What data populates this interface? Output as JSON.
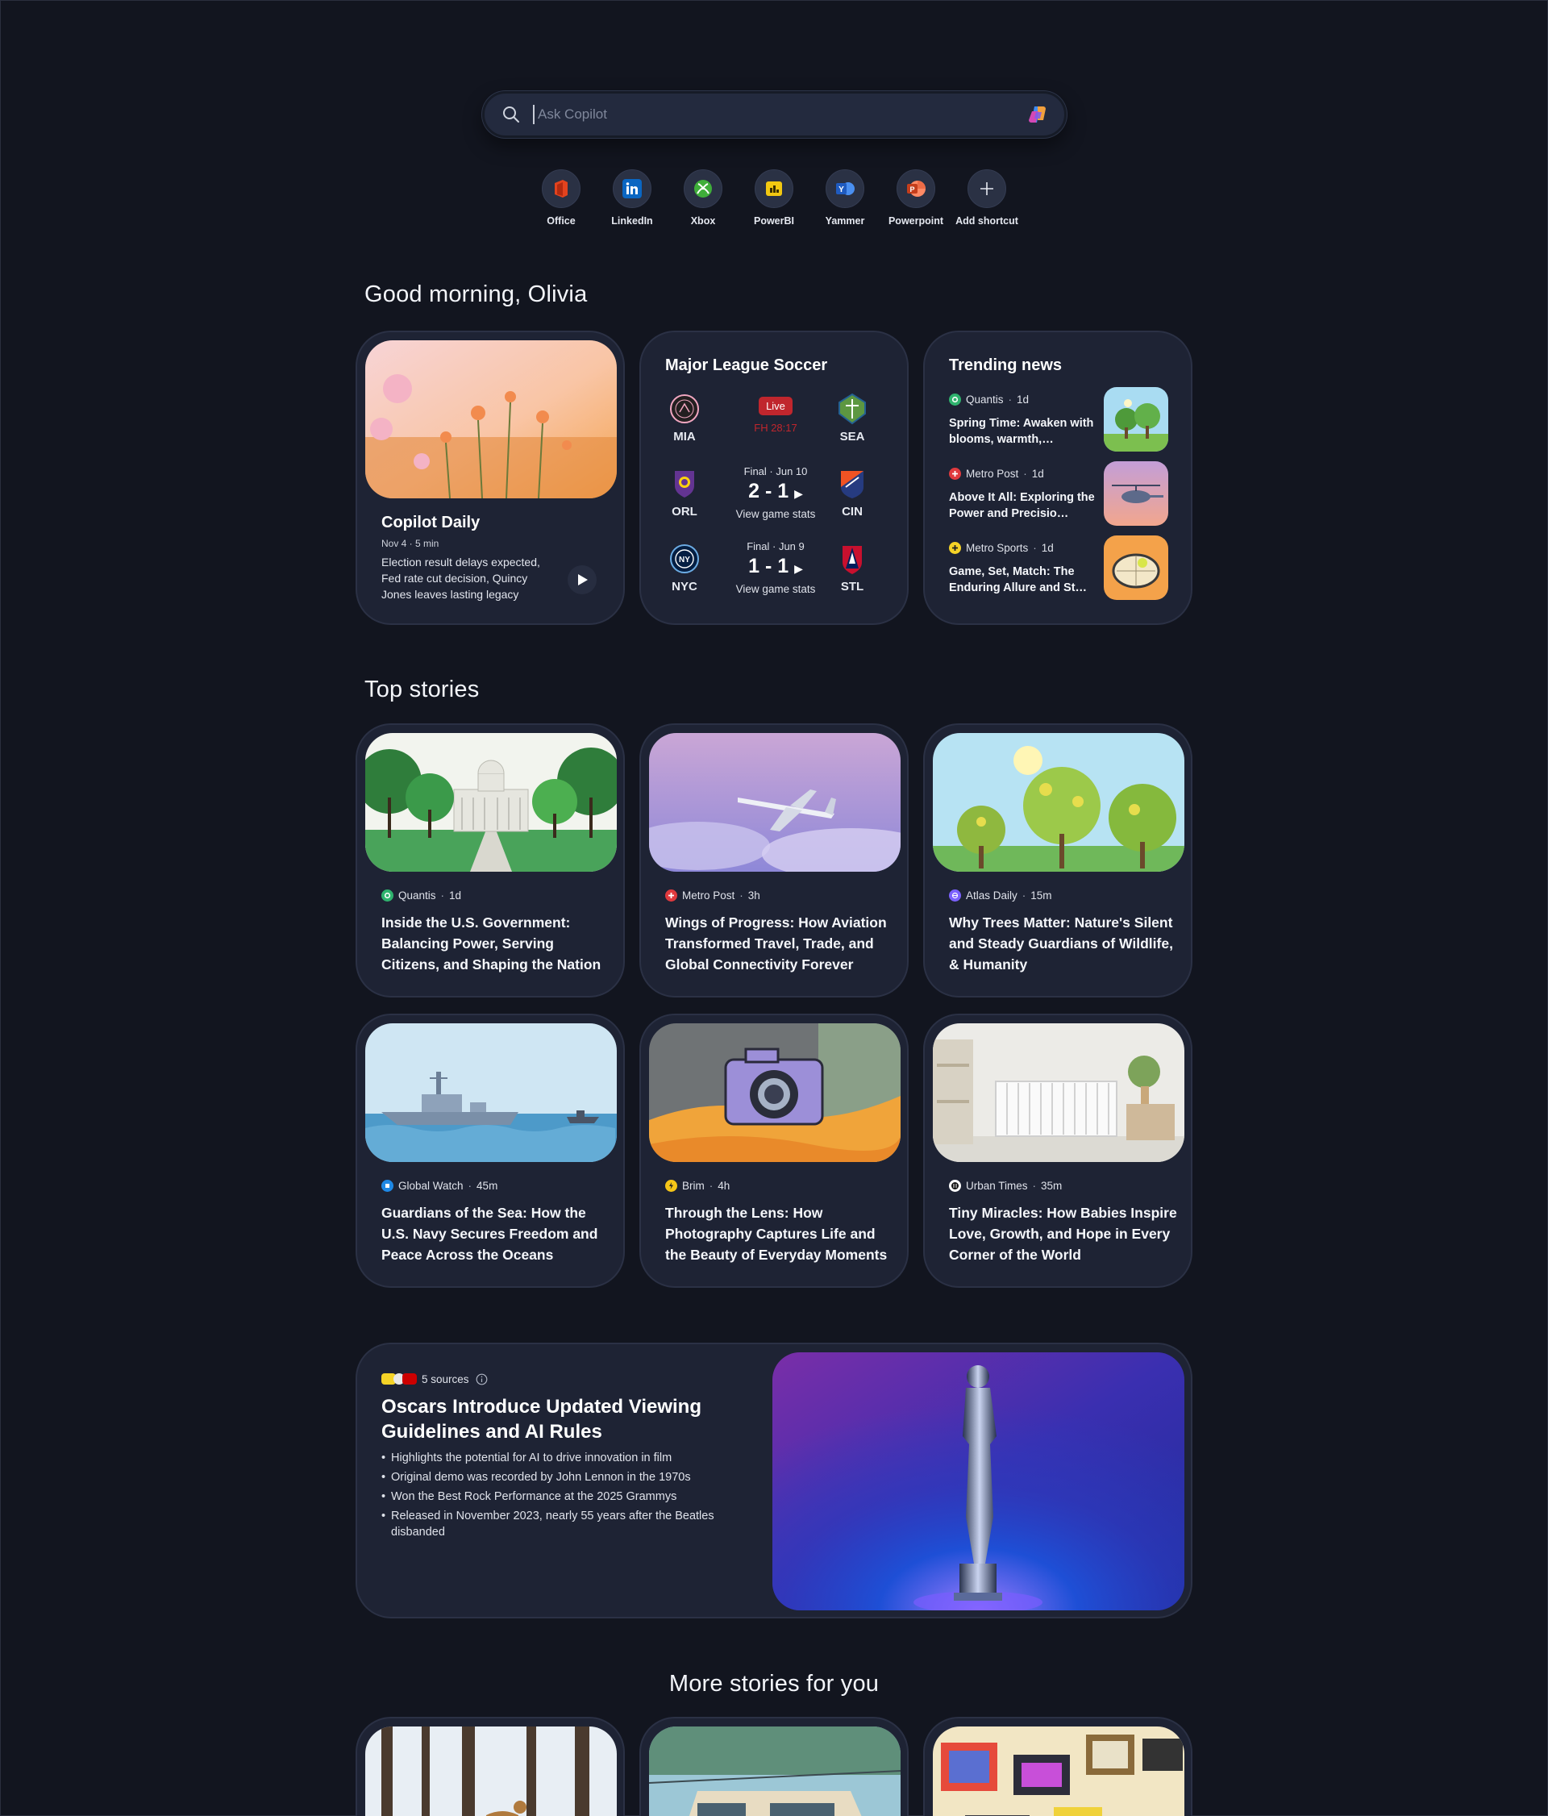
{
  "search": {
    "placeholder": "Ask Copilot"
  },
  "shortcuts": [
    {
      "label": "Office",
      "icon": "office-icon",
      "color": "#e2431e"
    },
    {
      "label": "LinkedIn",
      "icon": "linkedin-icon",
      "color": "#0a66c2"
    },
    {
      "label": "Xbox",
      "icon": "xbox-icon",
      "color": "#3fae3a"
    },
    {
      "label": "PowerBI",
      "icon": "powerbi-icon",
      "color": "#f2c811"
    },
    {
      "label": "Yammer",
      "icon": "yammer-icon",
      "color": "#2f6fd1"
    },
    {
      "label": "Powerpoint",
      "icon": "powerpoint-icon",
      "color": "#d24726"
    },
    {
      "label": "Add shortcut",
      "icon": "plus-icon",
      "color": "#ffffff"
    }
  ],
  "greeting": "Good morning, Olivia",
  "copilot_daily": {
    "title": "Copilot Daily",
    "meta": "Nov 4 · 5 min",
    "summary": "Election result delays expected, Fed rate cut decision, Quincy Jones leaves lasting legacy"
  },
  "soccer": {
    "title": "Major League Soccer",
    "matches": [
      {
        "home": "MIA",
        "away": "SEA",
        "status": "Live",
        "clock": "FH 28:17"
      },
      {
        "home": "ORL",
        "away": "CIN",
        "status": "Final · Jun 10",
        "score": "2 - 1",
        "link": "View game stats"
      },
      {
        "home": "NYC",
        "away": "STL",
        "status": "Final · Jun 9",
        "score": "1 - 1",
        "link": "View game stats"
      }
    ]
  },
  "trending": {
    "title": "Trending news",
    "items": [
      {
        "source": "Quantis",
        "age": "1d",
        "headline": "Spring Time: Awaken with blooms, warmth,…"
      },
      {
        "source": "Metro Post",
        "age": "1d",
        "headline": "Above It All: Exploring the Power and Precisio…"
      },
      {
        "source": "Metro Sports",
        "age": "1d",
        "headline": "Game, Set, Match: The Enduring Allure and St…"
      }
    ]
  },
  "top_stories_title": "Top stories",
  "stories": [
    {
      "source": "Quantis",
      "age": "1d",
      "headline": "Inside the U.S. Government: Balancing Power, Serving Citizens, and Shaping the Nation"
    },
    {
      "source": "Metro Post",
      "age": "3h",
      "headline": "Wings of Progress: How Aviation Transformed Travel, Trade, and Global Connectivity Forever"
    },
    {
      "source": "Atlas Daily",
      "age": "15m",
      "headline": "Why Trees Matter: Nature's Silent and Steady Guardians of Wildlife, & Humanity"
    },
    {
      "source": "Global Watch",
      "age": "45m",
      "headline": "Guardians of the Sea: How the U.S. Navy Secures Freedom and Peace Across the Oceans"
    },
    {
      "source": "Brim",
      "age": "4h",
      "headline": "Through the Lens: How Photography Captures Life and the Beauty of Everyday Moments"
    },
    {
      "source": "Urban Times",
      "age": "35m",
      "headline": "Tiny Miracles: How Babies Inspire Love, Growth, and Hope in Every Corner of the World"
    }
  ],
  "feature": {
    "sources": "5 sources",
    "title": "Oscars Introduce Updated Viewing Guidelines and AI Rules",
    "bullets": [
      "Highlights the potential for AI to drive innovation in film",
      "Original demo was recorded by John Lennon in the 1970s",
      "Won the Best Rock Performance at the 2025 Grammys",
      "Released in November 2023, nearly 55 years after the Beatles disbanded"
    ]
  },
  "more_stories_title": "More stories for you",
  "colors": {
    "background": "#12151f",
    "card": "#1e2334",
    "live": "#c0262d"
  }
}
